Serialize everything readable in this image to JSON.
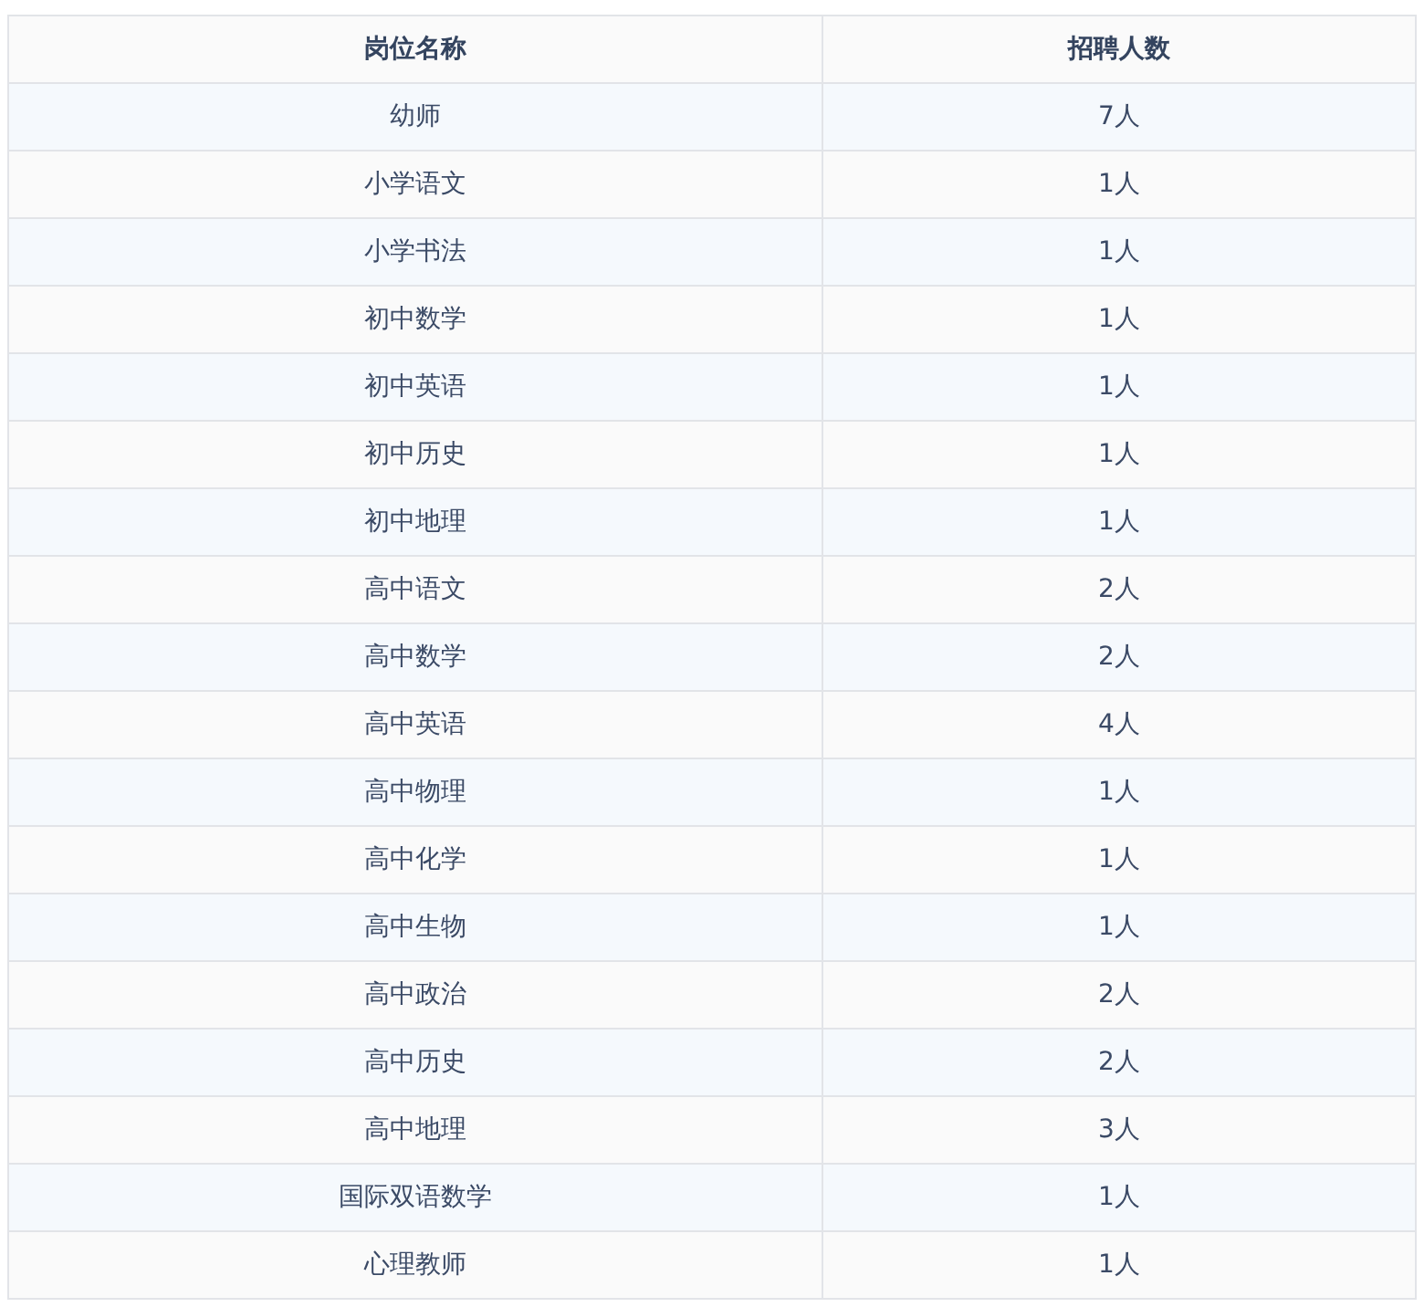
{
  "table": {
    "columns": [
      "岗位名称",
      "招聘人数"
    ],
    "rows": [
      [
        "幼师",
        "7人"
      ],
      [
        "小学语文",
        "1人"
      ],
      [
        "小学书法",
        "1人"
      ],
      [
        "初中数学",
        "1人"
      ],
      [
        "初中英语",
        "1人"
      ],
      [
        "初中历史",
        "1人"
      ],
      [
        "初中地理",
        "1人"
      ],
      [
        "高中语文",
        "2人"
      ],
      [
        "高中数学",
        "2人"
      ],
      [
        "高中英语",
        "4人"
      ],
      [
        "高中物理",
        "1人"
      ],
      [
        "高中化学",
        "1人"
      ],
      [
        "高中生物",
        "1人"
      ],
      [
        "高中政治",
        "2人"
      ],
      [
        "高中历史",
        "2人"
      ],
      [
        "高中地理",
        "3人"
      ],
      [
        "国际双语数学",
        "1人"
      ],
      [
        "心理教师",
        "1人"
      ]
    ]
  }
}
